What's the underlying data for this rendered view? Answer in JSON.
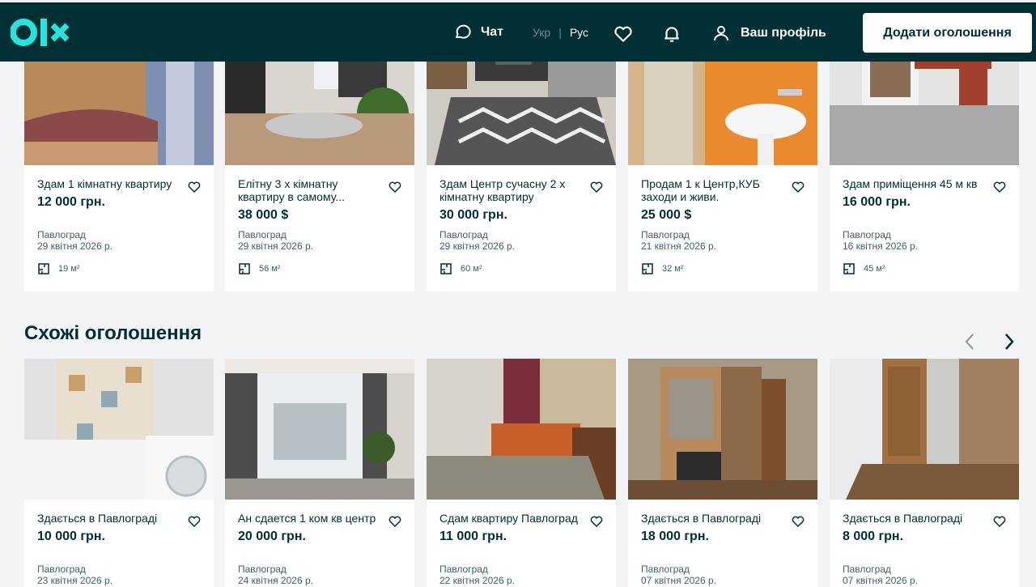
{
  "header": {
    "chat_label": "Чат",
    "lang_ukr": "Укр",
    "lang_sep": "|",
    "lang_rus": "Рус",
    "profile_label": "Ваш профіль",
    "add_button_label": "Додати оголошення",
    "brand_color": "#002f34"
  },
  "top_listings": [
    {
      "title": "Здам 1 кімнатну квартиру",
      "price": "12 000 грн.",
      "city": "Павлоград",
      "date": "29 квітня 2026 р.",
      "area": "19 м²"
    },
    {
      "title": "Елітну 3 х кімнатну квартиру в самому...",
      "price": "38 000 $",
      "city": "Павлоград",
      "date": "29 квітня 2026 р.",
      "area": "56 м²"
    },
    {
      "title": "Здам Центр сучасну 2 х кімнатну квартиру",
      "price": "30 000 грн.",
      "city": "Павлоград",
      "date": "29 квітня 2026 р.",
      "area": "60 м²"
    },
    {
      "title": "Продам 1 к Центр,КУБ заходи и живи.",
      "price": "25 000 $",
      "city": "Павлоград",
      "date": "21 квітня 2026 р.",
      "area": "32 м²"
    },
    {
      "title": "Здам приміщення 45 м кв",
      "price": "16 000 грн.",
      "city": "Павлоград",
      "date": "16 квітня 2026 р.",
      "area": "45 м²"
    }
  ],
  "similar": {
    "title": "Схожі оголошення",
    "listings": [
      {
        "title": "Здається в Павлограді",
        "price": "10 000 грн.",
        "city": "Павлоград",
        "date": "23 квітня 2026 р."
      },
      {
        "title": "Ан сдается 1 ком кв центр",
        "price": "20 000 грн.",
        "city": "Павлоград",
        "date": "24 квітня 2026 р."
      },
      {
        "title": "Сдам квартиру Павлоград",
        "price": "11 000 грн.",
        "city": "Павлоград",
        "date": "22 квітня 2026 р."
      },
      {
        "title": "Здається в Павлограді",
        "price": "18 000 грн.",
        "city": "Павлоград",
        "date": "07 квітня 2026 р."
      },
      {
        "title": "Здається в Павлограді",
        "price": "8 000 грн.",
        "city": "Павлоград",
        "date": "07 квітня 2026 р."
      }
    ]
  }
}
